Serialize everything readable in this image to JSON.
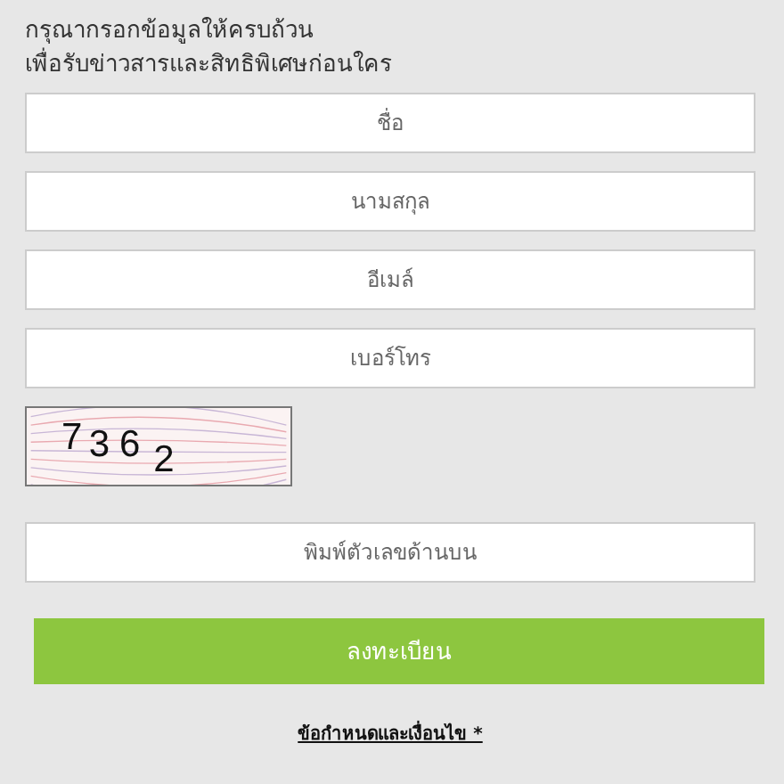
{
  "heading": [
    "กรุณากรอกข้อมูลให้ครบถ้วน",
    "เพื่อรับข่าวสารและสิทธิพิเศษก่อนใคร"
  ],
  "fields": [
    {
      "placeholder": "ชื่อ"
    },
    {
      "placeholder": "นามสกุล"
    },
    {
      "placeholder": "อีเมล์"
    },
    {
      "placeholder": "เบอร์โทร"
    }
  ],
  "captcha": {
    "digits": [
      "7",
      "3",
      "6",
      "2"
    ]
  },
  "captcha_field": {
    "placeholder": "พิมพ์ตัวเลขด้านบน"
  },
  "submit_button": "ลงทะเบียน",
  "terms_link": "ข้อกำหนดและเงื่อนไข *"
}
